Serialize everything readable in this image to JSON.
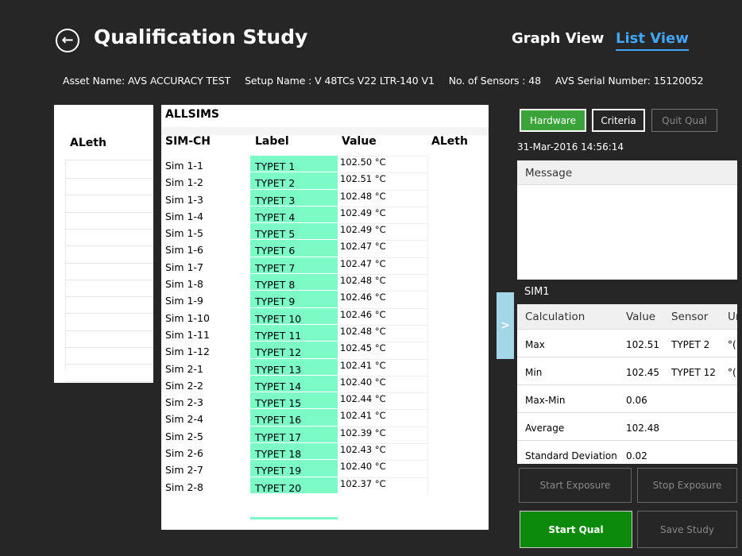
{
  "header": {
    "back_icon": "←",
    "title": "Qualification Study",
    "tabs": {
      "graph": "Graph View",
      "list": "List View"
    }
  },
  "info": {
    "asset": "Asset Name: AVS ACCURACY TEST",
    "setup": "Setup Name : V 48TCs V22 LTR-140 V1",
    "sensors": "No. of Sensors : 48",
    "serial": "AVS Serial Number:  15120052"
  },
  "left_panel": {
    "header": "ALeth"
  },
  "table": {
    "group": "ALLSIMS",
    "columns": [
      "SIM-CH",
      "Label",
      "Value",
      "ALeth"
    ],
    "rows": [
      [
        "Sim 1-1",
        "TYPET 1",
        "102.50 °C"
      ],
      [
        "Sim 1-2",
        "TYPET 2",
        "102.51 °C"
      ],
      [
        "Sim 1-3",
        "TYPET 3",
        "102.48 °C"
      ],
      [
        "Sim 1-4",
        "TYPET 4",
        "102.49 °C"
      ],
      [
        "Sim 1-5",
        "TYPET 5",
        "102.49 °C"
      ],
      [
        "Sim 1-6",
        "TYPET 6",
        "102.47 °C"
      ],
      [
        "Sim 1-7",
        "TYPET 7",
        "102.47 °C"
      ],
      [
        "Sim 1-8",
        "TYPET 8",
        "102.48 °C"
      ],
      [
        "Sim 1-9",
        "TYPET 9",
        "102.46 °C"
      ],
      [
        "Sim 1-10",
        "TYPET 10",
        "102.46 °C"
      ],
      [
        "Sim 1-11",
        "TYPET 11",
        "102.48 °C"
      ],
      [
        "Sim 1-12",
        "TYPET 12",
        "102.45 °C"
      ],
      [
        "Sim 2-1",
        "TYPET 13",
        "102.41 °C"
      ],
      [
        "Sim 2-2",
        "TYPET 14",
        "102.40 °C"
      ],
      [
        "Sim 2-3",
        "TYPET 15",
        "102.44 °C"
      ],
      [
        "Sim 2-4",
        "TYPET 16",
        "102.41 °C"
      ],
      [
        "Sim 2-5",
        "TYPET 17",
        "102.39 °C"
      ],
      [
        "Sim 2-6",
        "TYPET 18",
        "102.43 °C"
      ],
      [
        "Sim 2-7",
        "TYPET 19",
        "102.40 °C"
      ],
      [
        "Sim 2-8",
        "TYPET 20",
        "102.37 °C"
      ]
    ],
    "label_color": "#7dfbc7"
  },
  "collapse_tab": {
    "icon": ">"
  },
  "right_panel": {
    "buttons": {
      "hardware": "Hardware",
      "criteria": "Criteria",
      "quit": "Quit Qual"
    },
    "timestamp": "31-Mar-2016 14:56:14",
    "message_header": "Message",
    "sim_label": "SIM1",
    "calc_columns": [
      "Calculation",
      "Value",
      "Sensor",
      "Ur"
    ],
    "calc_rows": [
      [
        "Max",
        "102.51",
        "TYPET 2",
        "°("
      ],
      [
        "Min",
        "102.45",
        "TYPET 12",
        "°("
      ],
      [
        "Max-Min",
        "0.06",
        "",
        ""
      ],
      [
        "Average",
        "102.48",
        "",
        ""
      ],
      [
        "Standard Deviation",
        "0.02",
        "",
        ""
      ]
    ],
    "actions": {
      "start_exposure": "Start Exposure",
      "stop_exposure": "Stop Exposure",
      "start_qual": "Start Qual",
      "save_study": "Save Study"
    }
  },
  "colors": {
    "accent_blue": "#42a5f5",
    "green": "#0b8a0b",
    "hardware_green": "#3aa43a",
    "collapse_tab": "#a3d6e6"
  }
}
